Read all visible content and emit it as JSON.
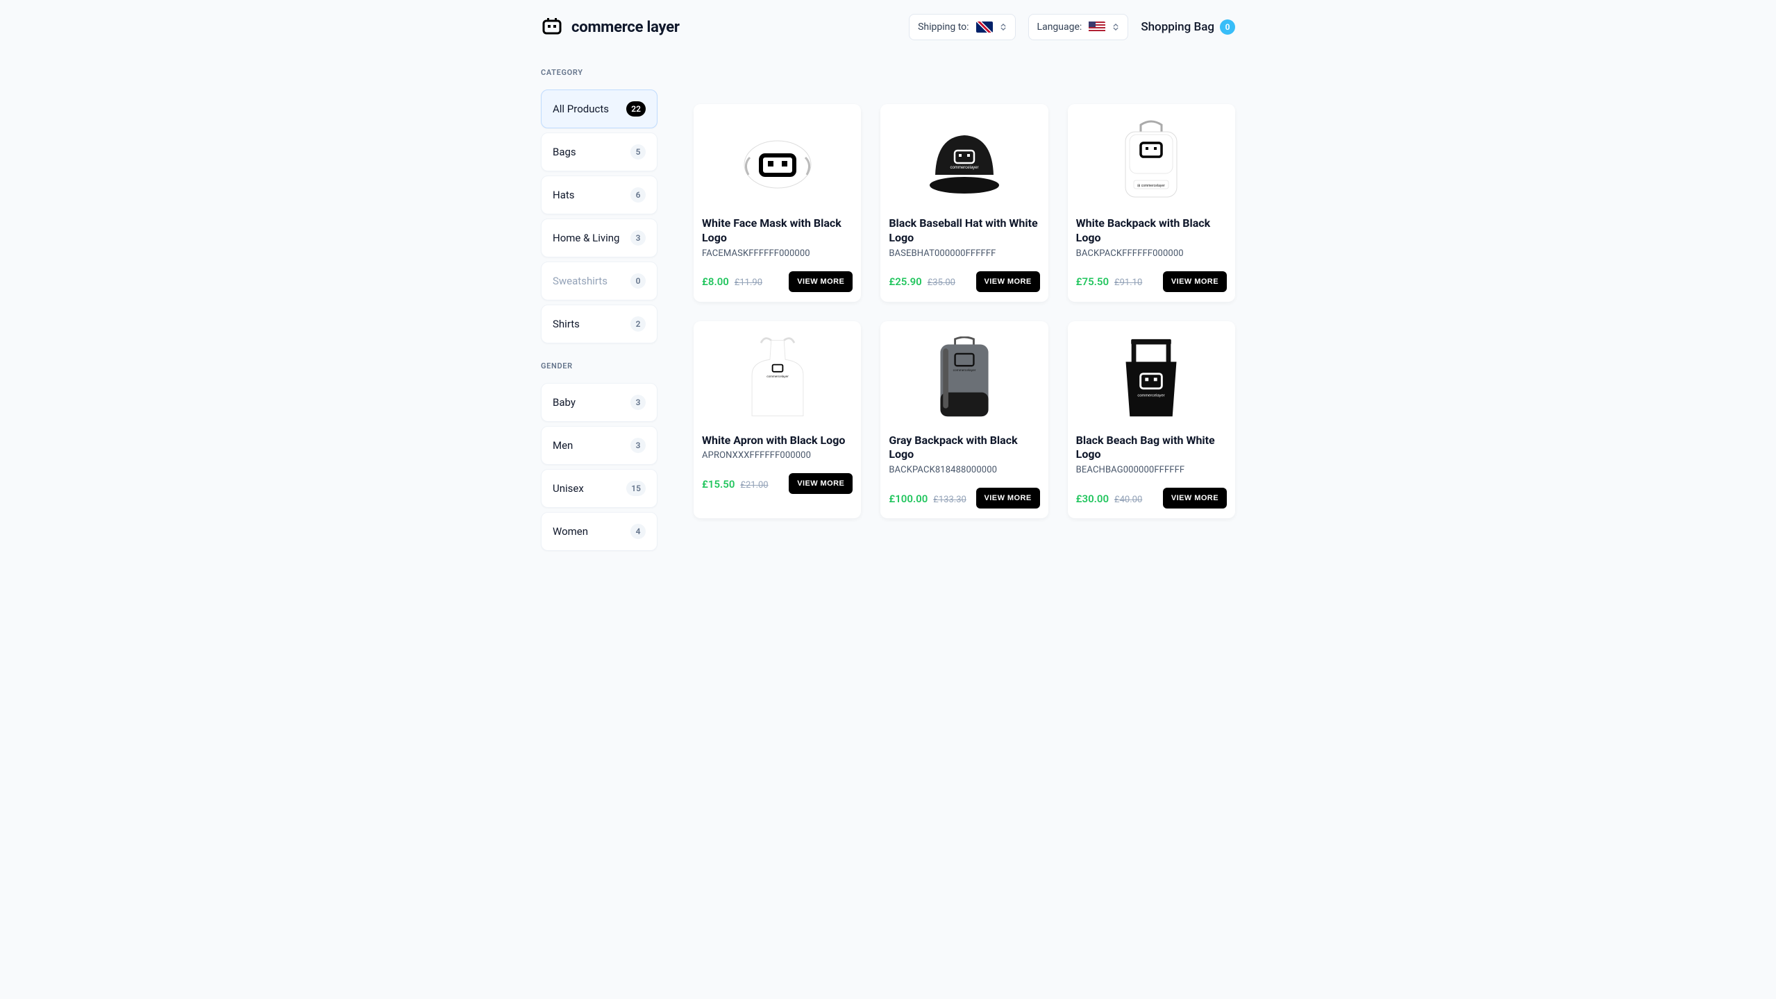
{
  "header": {
    "brand_name": "commerce layer",
    "shipping_label": "Shipping to:",
    "language_label": "Language:",
    "cart_label": "Shopping Bag",
    "cart_count": "0"
  },
  "sidebar": {
    "category_label": "CATEGORY",
    "gender_label": "GENDER",
    "categories": [
      {
        "label": "All Products",
        "count": "22",
        "active": true
      },
      {
        "label": "Bags",
        "count": "5"
      },
      {
        "label": "Hats",
        "count": "6"
      },
      {
        "label": "Home & Living",
        "count": "3"
      },
      {
        "label": "Sweatshirts",
        "count": "0",
        "disabled": true
      },
      {
        "label": "Shirts",
        "count": "2"
      }
    ],
    "genders": [
      {
        "label": "Baby",
        "count": "3"
      },
      {
        "label": "Men",
        "count": "3"
      },
      {
        "label": "Unisex",
        "count": "15"
      },
      {
        "label": "Women",
        "count": "4"
      }
    ]
  },
  "buttons": {
    "view_more": "VIEW MORE"
  },
  "products": [
    {
      "title": "White Face Mask with Black Logo",
      "sku": "FACEMASKFFFFFF000000",
      "sale": "£8.00",
      "orig": "£11.90"
    },
    {
      "title": "Black Baseball Hat with White Logo",
      "sku": "BASEBHAT000000FFFFFF",
      "sale": "£25.90",
      "orig": "£35.00"
    },
    {
      "title": "White Backpack with Black Logo",
      "sku": "BACKPACKFFFFFF000000",
      "sale": "£75.50",
      "orig": "£91.10"
    },
    {
      "title": "White Apron with Black Logo",
      "sku": "APRONXXXFFFFFF000000",
      "sale": "£15.50",
      "orig": "£21.00"
    },
    {
      "title": "Gray Backpack with Black Logo",
      "sku": "BACKPACK818488000000",
      "sale": "£100.00",
      "orig": "£133.30"
    },
    {
      "title": "Black Beach Bag with White Logo",
      "sku": "BEACHBAG000000FFFFFF",
      "sale": "£30.00",
      "orig": "£40.00"
    }
  ]
}
